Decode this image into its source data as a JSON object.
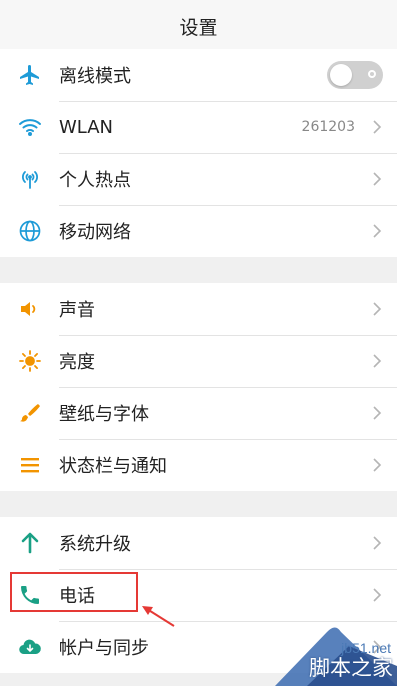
{
  "header": {
    "title": "设置"
  },
  "group1": {
    "items": [
      {
        "label": "离线模式"
      },
      {
        "label": "WLAN",
        "value": "261203"
      },
      {
        "label": "个人热点"
      },
      {
        "label": "移动网络"
      }
    ]
  },
  "group2": {
    "items": [
      {
        "label": "声音"
      },
      {
        "label": "亮度"
      },
      {
        "label": "壁纸与字体"
      },
      {
        "label": "状态栏与通知"
      }
    ]
  },
  "group3": {
    "items": [
      {
        "label": "系统升级"
      },
      {
        "label": "电话"
      },
      {
        "label": "帐户与同步"
      }
    ]
  },
  "watermark": {
    "site": "jb51.net",
    "name": "脚本之家"
  },
  "colors": {
    "blue_icon": "#1e9bd7",
    "orange_icon": "#f29400",
    "green_icon": "#1aa085",
    "highlight": "#e53935"
  }
}
